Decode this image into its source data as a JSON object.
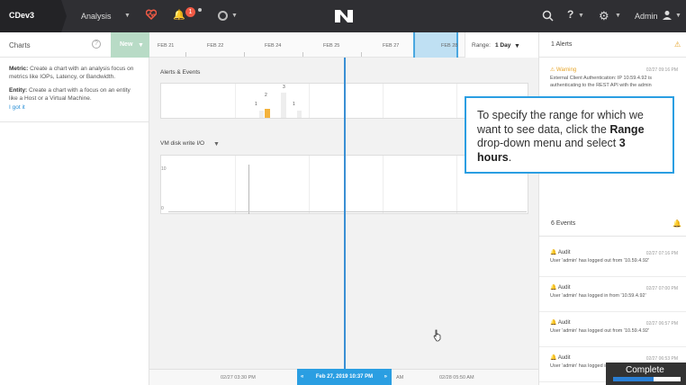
{
  "nav": {
    "cluster": "CDev3",
    "analysis": "Analysis",
    "alert_count": "1",
    "admin": "Admin"
  },
  "left": {
    "title": "Charts",
    "metric_label": "Metric:",
    "metric_text": " Create a chart with an analysis focus on metrics like IOPs, Latency, or Bandwidth.",
    "entity_label": "Entity:",
    "entity_text": " Create a chart with a focus on an entity like a Host or a Virtual Machine.",
    "got_it": "I got it"
  },
  "timeline": {
    "new_label": "New",
    "ticks": [
      "FEB 21",
      "FEB 22",
      "FEB 24",
      "FEB 25",
      "FEB 27",
      "FEB 28"
    ],
    "range_label": "Range:",
    "range_value": "1 Day"
  },
  "charts": {
    "alerts_title": "Alerts & Events",
    "bars": [
      "1",
      "2",
      "3",
      "1"
    ],
    "vm_title": "VM disk write I/O",
    "vm_ylabels": [
      "10",
      "0"
    ]
  },
  "bottom_axis": {
    "left_time": "02/27 03:30 PM",
    "mid_time": "AM",
    "right_time": "02/28 05:50 AM",
    "selected_date": "Feb 27, 2019 10:37 PM"
  },
  "right": {
    "alerts_head": "1 Alerts",
    "alert_title": "Warning",
    "alert_time": "02/27 09:16 PM",
    "alert_body": "External Client Authentication: IP 10.59.4.92 is authenticating to the REST API with the admin",
    "events_head": "6 Events",
    "events": [
      {
        "title": "Audit",
        "time": "02/27 07:16 PM",
        "body": "User 'admin' has logged out from '10.59.4.92'"
      },
      {
        "title": "Audit",
        "time": "02/27 07:00 PM",
        "body": "User 'admin' has logged in from '10.59.4.92'"
      },
      {
        "title": "Audit",
        "time": "02/27 06:57 PM",
        "body": "User 'admin' has logged out from '10.59.4.92'"
      },
      {
        "title": "Audit",
        "time": "02/27 06:53 PM",
        "body": "User 'admin' has logged in from '10.59.4.92'"
      }
    ]
  },
  "callout": {
    "before": "To specify the range for which we want to see data, click the ",
    "range_word": "Range",
    "middle": " drop-down menu and select ",
    "hours": "3 hours",
    "end": "."
  },
  "status": {
    "complete": "Complete",
    "progress": 0.6
  }
}
